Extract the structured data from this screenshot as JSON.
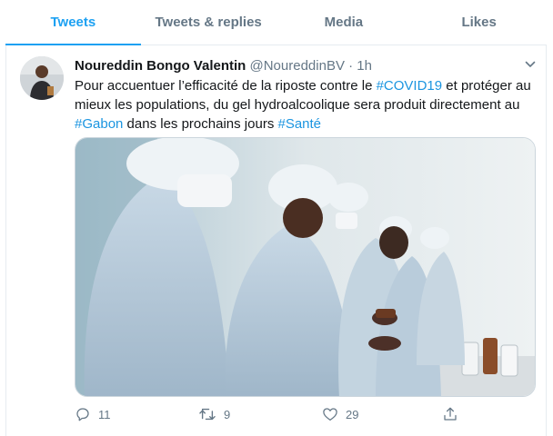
{
  "tabs": [
    {
      "label": "Tweets",
      "active": true
    },
    {
      "label": "Tweets & replies",
      "active": false
    },
    {
      "label": "Media",
      "active": false
    },
    {
      "label": "Likes",
      "active": false
    }
  ],
  "tweet": {
    "author_name": "Noureddin Bongo Valentin",
    "handle": "@NoureddinBV",
    "separator": "·",
    "time": "1h",
    "text_part1": "Pour accuentuer l’efficacité de la riposte contre le ",
    "hashtag1": "#COVID19",
    "text_part2": " et protéger au mieux les populations, du gel hydroalcoolique sera produit directement au ",
    "hashtag2": "#Gabon",
    "text_part3": " dans les prochains jours ",
    "hashtag3": "#Santé",
    "actions": {
      "reply_count": "11",
      "retweet_count": "9",
      "like_count": "29"
    }
  },
  "icons": {
    "reply": "reply-icon",
    "retweet": "retweet-icon",
    "like": "heart-icon",
    "share": "share-icon",
    "caret": "chevron-down-icon"
  },
  "colors": {
    "accent": "#1da1f2",
    "hashtag": "#1b95e0",
    "muted": "#657786"
  }
}
